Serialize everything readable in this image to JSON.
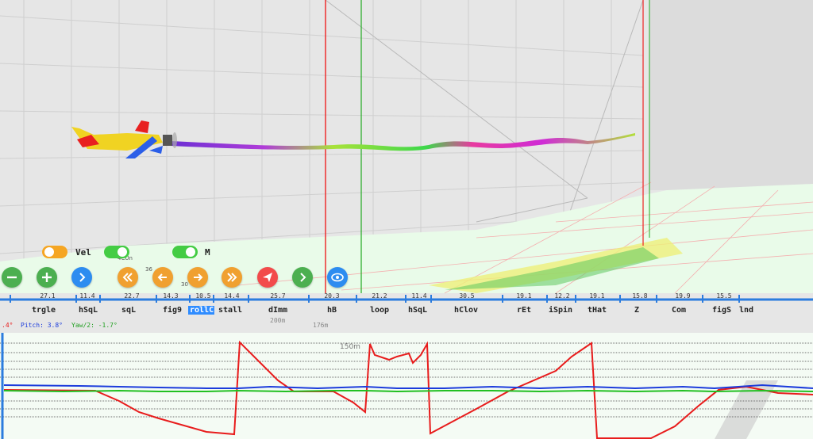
{
  "toggles": [
    {
      "label": "Vel",
      "on": true,
      "color": "#f5a623"
    },
    {
      "label": "",
      "on": true,
      "color": "#44cc44"
    },
    {
      "label": "M",
      "on": true,
      "color": "#44cc44"
    }
  ],
  "scene_labels": {
    "a": "200m",
    "b": "176m",
    "c": "150m",
    "d": "4CUn",
    "e": "36",
    "f": "30"
  },
  "controls": [
    {
      "name": "zoom-out",
      "color": "#4caf50",
      "icon": "minus-icon"
    },
    {
      "name": "zoom-in",
      "color": "#4caf50",
      "icon": "plus-icon"
    },
    {
      "name": "next",
      "color": "#2d8cf0",
      "icon": "chevron-right-icon"
    },
    {
      "name": "fast-back",
      "color": "#f0a030",
      "icon": "double-chevron-left-icon"
    },
    {
      "name": "step-back",
      "color": "#f0a030",
      "icon": "arrow-left-icon"
    },
    {
      "name": "step-forward",
      "color": "#f0a030",
      "icon": "arrow-right-icon"
    },
    {
      "name": "fast-forward",
      "color": "#f0a030",
      "icon": "double-chevron-right-icon"
    },
    {
      "name": "send",
      "color": "#f24b4b",
      "icon": "paper-plane-icon"
    },
    {
      "name": "play-next",
      "color": "#4caf50",
      "icon": "chevron-right-icon"
    },
    {
      "name": "view",
      "color": "#2d8cf0",
      "icon": "eye-icon"
    }
  ],
  "maneuvers": [
    {
      "name": "trgle",
      "duration": "27.1"
    },
    {
      "name": "hSqL",
      "duration": "11.4"
    },
    {
      "name": "sqL",
      "duration": "22.7"
    },
    {
      "name": "fig9",
      "duration": "14.3"
    },
    {
      "name": "rollC",
      "duration": "10.5",
      "active": true
    },
    {
      "name": "stall",
      "duration": "14.4"
    },
    {
      "name": "dImm",
      "duration": "25.7"
    },
    {
      "name": "hB",
      "duration": "20.3"
    },
    {
      "name": "loop",
      "duration": "21.2"
    },
    {
      "name": "hSqL",
      "duration": "11.4"
    },
    {
      "name": "hClov",
      "duration": "30.5"
    },
    {
      "name": "rEt",
      "duration": "19.1"
    },
    {
      "name": "iSpin",
      "duration": "12.2"
    },
    {
      "name": "tHat",
      "duration": "19.1"
    },
    {
      "name": "Z",
      "duration": "15.8"
    },
    {
      "name": "Com",
      "duration": "19.9"
    },
    {
      "name": "figS",
      "duration": "15.5"
    },
    {
      "name": "lnd",
      "duration": ""
    }
  ],
  "readout": {
    "roll": ".4°",
    "pitch": "Pitch: 3.8°",
    "yaw": "Yaw/2: -1.7°"
  },
  "colors": {
    "timeline": "#2b7cde",
    "roll_trace": "#e81c1c",
    "pitch_trace": "#1c3cdc",
    "yaw_trace": "#22c022"
  }
}
